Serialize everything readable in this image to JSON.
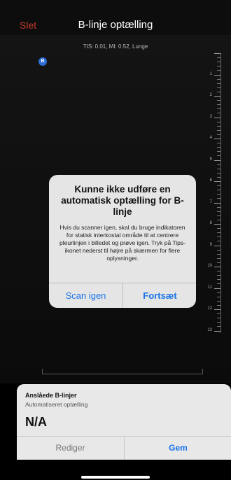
{
  "nav": {
    "delete_label": "Slet",
    "title": "B-linje optælling"
  },
  "scan": {
    "tis_text": "TIS: 0.01, MI: 0.52, Lunge",
    "marker_label": "B",
    "depth_labels": [
      "1",
      "2",
      "3",
      "4",
      "5",
      "6",
      "7",
      "8",
      "9",
      "10",
      "11",
      "12",
      "13"
    ]
  },
  "alert": {
    "title": "Kunne ikke udføre en automatisk optælling for B-linje",
    "message": "Hvis du scanner igen, skal du bruge indikatoren for statisk interkostal område til at centrere pleurlinjen i billedet og prøve igen. Tryk på Tips-ikonet nederst til højre på skærmen for flere oplysninger.",
    "scan_again": "Scan igen",
    "continue": "Fortsæt"
  },
  "result": {
    "title": "Anslåede B-linjer",
    "subtitle": "Automatiseret optælling",
    "value": "N/A",
    "edit": "Rediger",
    "save": "Gem"
  },
  "colors": {
    "accent": "#1a73e8",
    "delete": "#c0392b",
    "marker": "#2d6fd6"
  }
}
